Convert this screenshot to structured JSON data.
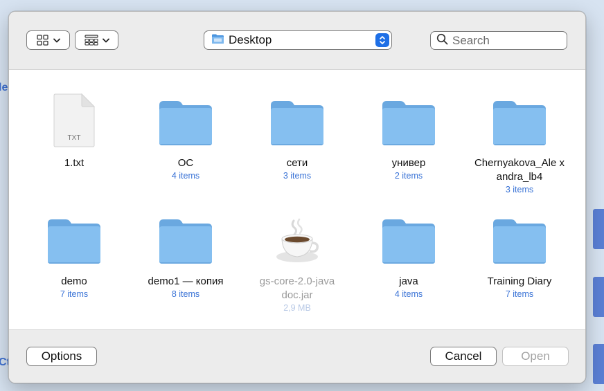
{
  "background": {
    "fragment_left_top": "le",
    "fragment_left_bottom": "Ct"
  },
  "toolbar": {
    "icon_view_label": "icon view",
    "group_view_label": "group view",
    "location": "Desktop",
    "search_placeholder": "Search"
  },
  "files": [
    {
      "name": "1.txt",
      "sub": "",
      "type": "txt",
      "badge": "TXT"
    },
    {
      "name": "ОС",
      "sub": "4 items",
      "type": "folder"
    },
    {
      "name": "сети",
      "sub": "3 items",
      "type": "folder"
    },
    {
      "name": "универ",
      "sub": "2 items",
      "type": "folder"
    },
    {
      "name": "Chernyakova_Ale xandra_lb4",
      "sub": "3 items",
      "type": "folder"
    },
    {
      "name": "demo",
      "sub": "7 items",
      "type": "folder"
    },
    {
      "name": "demo1 — копия",
      "sub": "8 items",
      "type": "folder"
    },
    {
      "name": "gs-core-2.0-javadoc.jar",
      "sub": "2,9 MB",
      "type": "jar",
      "disabled": true
    },
    {
      "name": "java",
      "sub": "4 items",
      "type": "folder"
    },
    {
      "name": "Training Diary",
      "sub": "7 items",
      "type": "folder"
    }
  ],
  "footer": {
    "options_label": "Options",
    "cancel_label": "Cancel",
    "open_label": "Open"
  },
  "colors": {
    "folder_top": "#6aa8e0",
    "folder_body": "#85bff0",
    "accent": "#1e6fe6",
    "item_count": "#3a73d6"
  }
}
